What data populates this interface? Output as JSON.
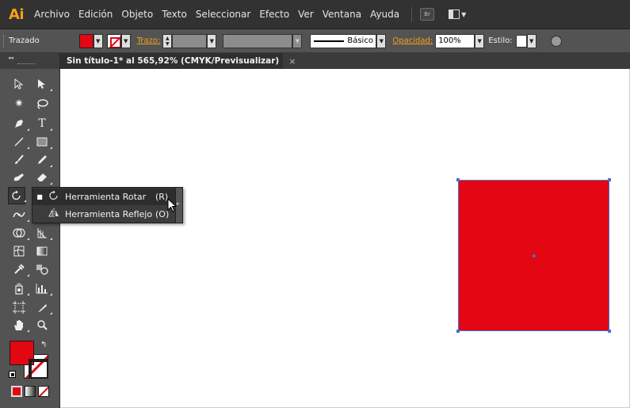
{
  "app": {
    "logo": "Ai",
    "menu": [
      "Archivo",
      "Edición",
      "Objeto",
      "Texto",
      "Seleccionar",
      "Efecto",
      "Ver",
      "Ventana",
      "Ayuda"
    ],
    "bridge_label": "Br"
  },
  "control_bar": {
    "selection_label": "Trazado",
    "stroke_label": "Trazo:",
    "stroke_profile": "Básico",
    "opacity_label": "Opacidad:",
    "opacity_value": "100%",
    "style_label": "Estilo:",
    "fill_color": "#e30613"
  },
  "document": {
    "tab_title": "Sin título-1* al 565,92% (CMYK/Previsualizar)",
    "close_glyph": "×"
  },
  "flyout": {
    "items": [
      {
        "label": "Herramienta Rotar",
        "shortcut": "(R)",
        "bullet": "■",
        "icon": "rotate-icon"
      },
      {
        "label": "Herramienta Reflejo",
        "shortcut": "(O)",
        "bullet": "",
        "icon": "reflect-icon"
      }
    ]
  },
  "artwork": {
    "shape": "rectangle",
    "fill": "#e30613",
    "selection_color": "#4b6cd6"
  }
}
